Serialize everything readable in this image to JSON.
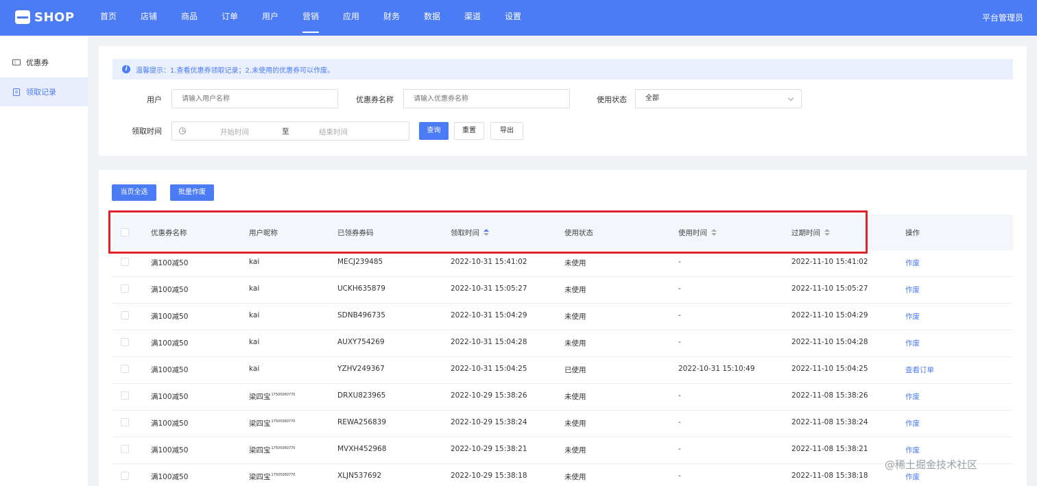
{
  "brand": {
    "logo_text": "SHOP"
  },
  "nav": {
    "items": [
      "首页",
      "店铺",
      "商品",
      "订单",
      "用户",
      "营销",
      "应用",
      "财务",
      "数据",
      "渠道",
      "设置"
    ],
    "active": "营销",
    "user": "平台管理员"
  },
  "sidebar": {
    "items": [
      {
        "label": "优惠券",
        "icon": "ticket-icon"
      },
      {
        "label": "领取记录",
        "icon": "clipboard-icon"
      }
    ],
    "active": "领取记录"
  },
  "notice": {
    "text": "温馨提示：1.查看优惠券领取记录；2.未使用的优惠券可以作废。"
  },
  "filters": {
    "user_label": "用户",
    "user_placeholder": "请输入用户名称",
    "coupon_label": "优惠券名称",
    "coupon_placeholder": "请输入优惠券名称",
    "status_label": "使用状态",
    "status_value": "全部",
    "time_label": "领取时间",
    "start_placeholder": "开始时间",
    "separator": "至",
    "end_placeholder": "结束时间",
    "query_button": "查询",
    "reset_button": "重置",
    "export_button": "导出"
  },
  "actions": {
    "select_page": "当页全选",
    "batch_void": "批量作废"
  },
  "table": {
    "headers": [
      "优惠券名称",
      "用户昵称",
      "已领券券码",
      "领取时间",
      "使用状态",
      "使用时间",
      "过期时间",
      "操作"
    ],
    "rows": [
      {
        "coupon": "满100减50",
        "nickname": "kai",
        "nick_sup": "",
        "code": "MECJ239485",
        "received": "2022-10-31 15:41:02",
        "status": "未使用",
        "used_at": "-",
        "expires": "2022-11-10 15:41:02",
        "action": "作废"
      },
      {
        "coupon": "满100减50",
        "nickname": "kai",
        "nick_sup": "",
        "code": "UCKH635879",
        "received": "2022-10-31 15:05:27",
        "status": "未使用",
        "used_at": "-",
        "expires": "2022-11-10 15:05:27",
        "action": "作废"
      },
      {
        "coupon": "满100减50",
        "nickname": "kai",
        "nick_sup": "",
        "code": "SDNB496735",
        "received": "2022-10-31 15:04:29",
        "status": "未使用",
        "used_at": "-",
        "expires": "2022-11-10 15:04:29",
        "action": "作废"
      },
      {
        "coupon": "满100减50",
        "nickname": "kai",
        "nick_sup": "",
        "code": "AUXY754269",
        "received": "2022-10-31 15:04:28",
        "status": "未使用",
        "used_at": "-",
        "expires": "2022-11-10 15:04:28",
        "action": "作废"
      },
      {
        "coupon": "满100减50",
        "nickname": "kai",
        "nick_sup": "",
        "code": "YZHV249367",
        "received": "2022-10-31 15:04:25",
        "status": "已使用",
        "used_at": "2022-10-31 15:10:49",
        "expires": "2022-11-10 15:04:25",
        "action": "查看订单"
      },
      {
        "coupon": "满100减50",
        "nickname": "梁四宝",
        "nick_sup": "17505060770",
        "code": "DRXU823965",
        "received": "2022-10-29 15:38:26",
        "status": "未使用",
        "used_at": "-",
        "expires": "2022-11-08 15:38:26",
        "action": "作废"
      },
      {
        "coupon": "满100减50",
        "nickname": "梁四宝",
        "nick_sup": "17505060770",
        "code": "REWA256839",
        "received": "2022-10-29 15:38:24",
        "status": "未使用",
        "used_at": "-",
        "expires": "2022-11-08 15:38:24",
        "action": "作废"
      },
      {
        "coupon": "满100减50",
        "nickname": "梁四宝",
        "nick_sup": "17505060770",
        "code": "MVXH452968",
        "received": "2022-10-29 15:38:21",
        "status": "未使用",
        "used_at": "-",
        "expires": "2022-11-08 15:38:21",
        "action": "作废"
      },
      {
        "coupon": "满100减50",
        "nickname": "梁四宝",
        "nick_sup": "17505060770",
        "code": "XLJN537692",
        "received": "2022-10-29 15:38:18",
        "status": "未使用",
        "used_at": "-",
        "expires": "2022-11-08 15:38:18",
        "action": "作废"
      }
    ]
  },
  "watermark": "@稀土掘金技术社区",
  "colors": {
    "primary": "#4b7bf5",
    "highlight_border": "#e0202a",
    "header_bg": "#f3f6fb"
  }
}
